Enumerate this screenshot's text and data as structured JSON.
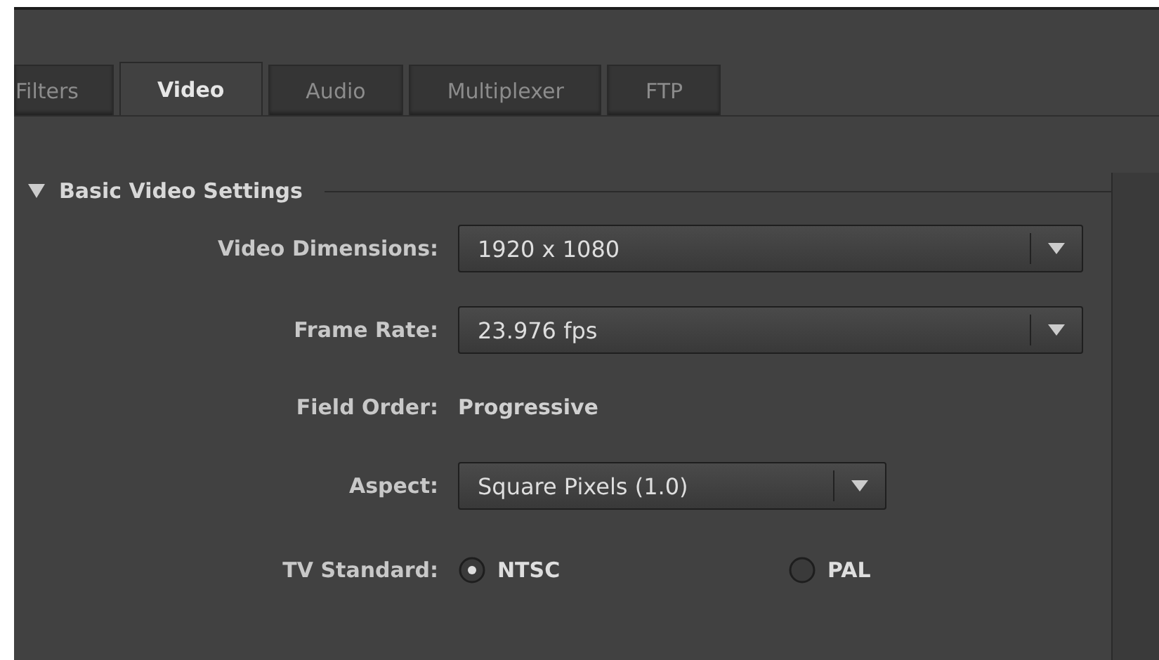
{
  "tabs": [
    {
      "label": "Filters",
      "selected": false
    },
    {
      "label": "Video",
      "selected": true
    },
    {
      "label": "Audio",
      "selected": false
    },
    {
      "label": "Multiplexer",
      "selected": false
    },
    {
      "label": "FTP",
      "selected": false
    }
  ],
  "section": {
    "title": "Basic Video Settings",
    "expanded": true,
    "rows": [
      {
        "kind": "dropdown",
        "label": "Video Dimensions:",
        "value": "1920 x 1080",
        "compact": false
      },
      {
        "kind": "dropdown",
        "label": "Frame Rate:",
        "value": "23.976 fps",
        "compact": false
      },
      {
        "kind": "text",
        "label": "Field Order:",
        "value": "Progressive"
      },
      {
        "kind": "dropdown",
        "label": "Aspect:",
        "value": "Square Pixels (1.0)",
        "compact": true
      },
      {
        "kind": "radio",
        "label": "TV Standard:",
        "options": [
          {
            "label": "NTSC",
            "selected": true
          },
          {
            "label": "PAL",
            "selected": false
          }
        ]
      }
    ]
  }
}
